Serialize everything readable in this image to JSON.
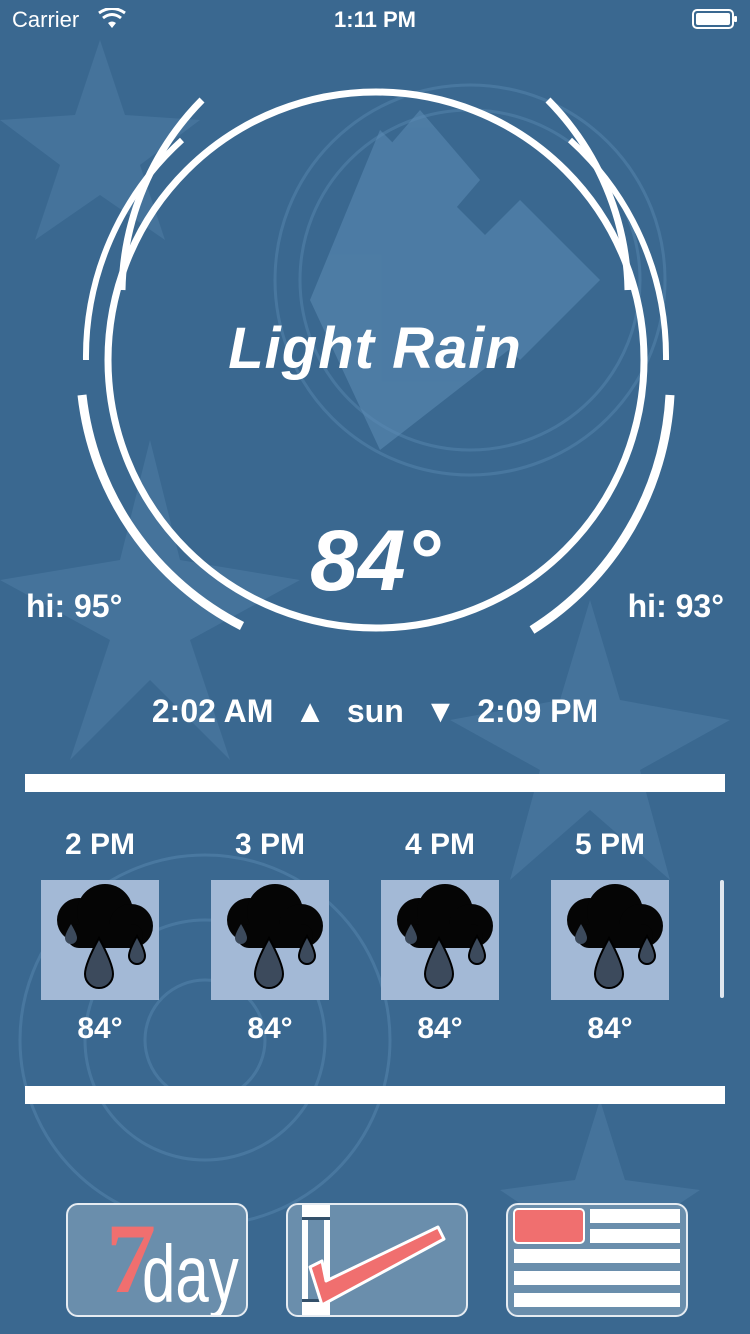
{
  "status_bar": {
    "carrier": "Carrier",
    "time": "1:11 PM"
  },
  "weather": {
    "condition": "Light Rain",
    "temperature": "84°",
    "hi_left": "hi: 95°",
    "hi_right": "hi: 93°"
  },
  "sun": {
    "rise": "2:02 AM",
    "label": "sun",
    "set": "2:09 PM",
    "up_arrow": "▲",
    "down_arrow": "▼"
  },
  "hourly": [
    {
      "time": "2 PM",
      "temp": "84°",
      "icon": "rain-cloud-icon"
    },
    {
      "time": "3 PM",
      "temp": "84°",
      "icon": "rain-cloud-icon"
    },
    {
      "time": "4 PM",
      "temp": "84°",
      "icon": "rain-cloud-icon"
    },
    {
      "time": "5 PM",
      "temp": "84°",
      "icon": "rain-cloud-icon"
    }
  ],
  "nav": {
    "seven_day_digit": "7",
    "seven_day_text": "day",
    "icons": [
      "seven-day-icon",
      "checkmark-icon",
      "list-icon"
    ]
  },
  "colors": {
    "background": "#3a6890",
    "accent_pink": "#f06f6f",
    "icon_tile": "#a3b9d6"
  }
}
